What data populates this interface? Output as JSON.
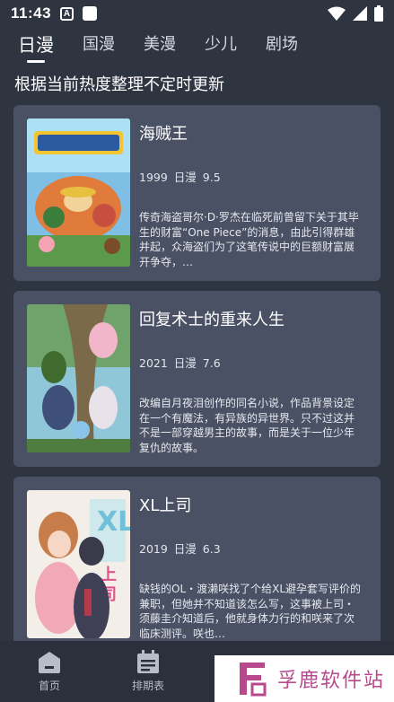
{
  "status": {
    "time": "11:43",
    "a_icon_letter": "A"
  },
  "tabs": [
    {
      "label": "日漫",
      "active": true
    },
    {
      "label": "国漫",
      "active": false
    },
    {
      "label": "美漫",
      "active": false
    },
    {
      "label": "少儿",
      "active": false
    },
    {
      "label": "剧场",
      "active": false
    }
  ],
  "subtitle": "根据当前热度整理不定时更新",
  "cards": [
    {
      "title": "海贼王",
      "year": "1999",
      "category": "日漫",
      "score": "9.5",
      "desc": "传奇海盗哥尔·D·罗杰在临死前曾留下关于其毕生的财富“One Piece”的消息，由此引得群雄并起，众海盗们为了这笔传说中的巨额财富展开争夺，…"
    },
    {
      "title": "回复术士的重来人生",
      "year": "2021",
      "category": "日漫",
      "score": "7.6",
      "desc": "改编自月夜泪创作的同名小说，作品背景设定在一个有魔法，有异族的异世界。只不过这并不是一部穿越男主的故事，而是关于一位少年复仇的故事。"
    },
    {
      "title": "XL上司",
      "year": "2019",
      "category": "日漫",
      "score": "6.3",
      "desc": "缺钱的OL・渡濑咲找了个给XL避孕套写评价的兼职，但她并不知道该怎么写，这事被上司・须藤圭介知道后，他就身体力行的和咲来了次临床测评。咲也…"
    }
  ],
  "bottom_nav": [
    {
      "label": "首页",
      "icon": "home-icon"
    },
    {
      "label": "排期表",
      "icon": "calendar-icon"
    }
  ],
  "watermark": {
    "text": "孚鹿软件站"
  }
}
